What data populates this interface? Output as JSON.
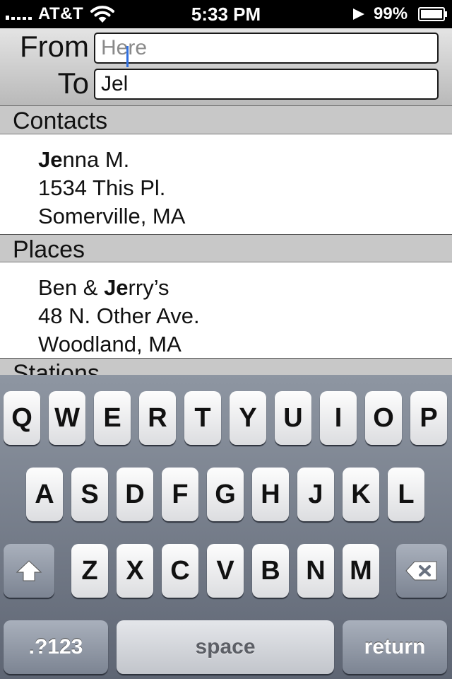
{
  "status_bar": {
    "carrier": "AT&T",
    "time": "5:33 PM",
    "battery_percent": "99%",
    "signal_bars": 1,
    "icons": [
      "signal-icon",
      "wifi-icon",
      "location-icon",
      "battery-icon"
    ]
  },
  "route": {
    "from_label": "From",
    "from_placeholder": "Here",
    "from_value": "",
    "to_label": "To",
    "to_value": "Jel"
  },
  "results": {
    "sections": [
      {
        "title": "Contacts",
        "items": [
          {
            "match": "Je",
            "name_rest": "nna M.",
            "line2": "1534 This Pl.",
            "line3": "Somerville, MA"
          }
        ]
      },
      {
        "title": "Places",
        "items": [
          {
            "prefix": "Ben & ",
            "match": "Je",
            "name_rest": "rry’s",
            "line2": "48 N. Other Ave.",
            "line3": "Woodland, MA"
          }
        ]
      },
      {
        "title": "Stations",
        "items": []
      }
    ]
  },
  "keyboard": {
    "row1": [
      "Q",
      "W",
      "E",
      "R",
      "T",
      "Y",
      "U",
      "I",
      "O",
      "P"
    ],
    "row2": [
      "A",
      "S",
      "D",
      "F",
      "G",
      "H",
      "J",
      "K",
      "L"
    ],
    "row3": [
      "Z",
      "X",
      "C",
      "V",
      "B",
      "N",
      "M"
    ],
    "mode_label": ".?123",
    "space_label": "space",
    "return_label": "return",
    "shift_icon": "shift-arrow-icon",
    "delete_icon": "backspace-icon"
  },
  "colors": {
    "caret": "#2f6fe0",
    "section_header_bg": "#c8c8c8",
    "keyboard_bg_top": "#8e96a2",
    "keyboard_bg_bottom": "#5e6573"
  }
}
